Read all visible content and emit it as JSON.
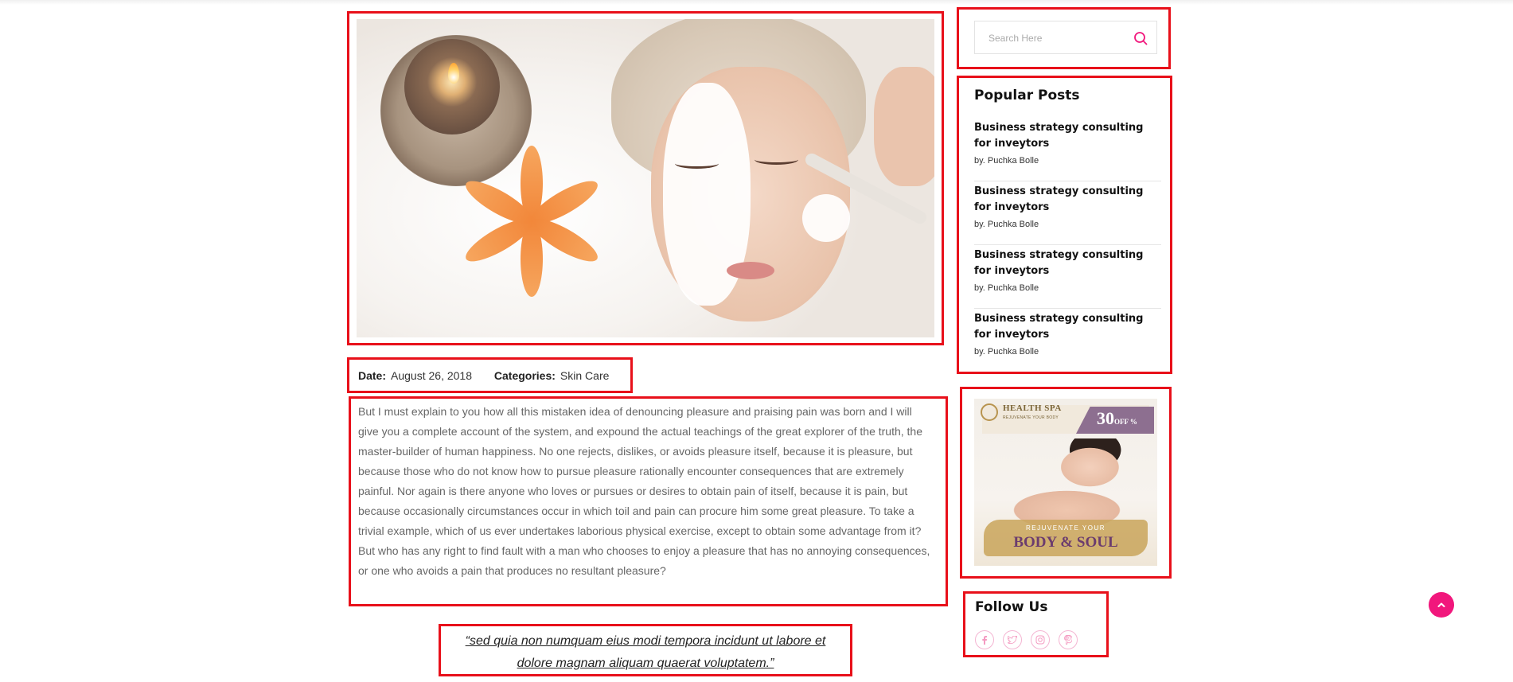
{
  "post": {
    "meta": {
      "date_label": "Date:",
      "date_value": "August 26, 2018",
      "categories_label": "Categories:",
      "categories_value": "Skin Care"
    },
    "body": "But I must explain to you how all this mistaken idea of denouncing pleasure and praising pain was born and I will give you a complete account of the system, and expound the actual teachings of the great explorer of the truth, the master-builder of human happiness. No one rejects, dislikes, or avoids pleasure itself, because it is pleasure, but because those who do not know how to pursue pleasure rationally encounter consequences that are extremely painful. Nor again is there anyone who loves or pursues or desires to obtain pain of itself, because it is pain, but because occasionally circumstances occur in which toil and pain can procure him some great pleasure. To take a trivial example, which of us ever undertakes laborious physical exercise, except to obtain some advantage from it? But who has any right to find fault with a man who chooses to enjoy a pleasure that has no annoying consequences, or one who avoids a pain that produces no resultant pleasure?",
    "quote": "“sed quia non numquam eius modi tempora incidunt ut labore et dolore magnam aliquam quaerat voluptatem.”"
  },
  "sidebar": {
    "search": {
      "placeholder": "Search Here",
      "icon": "search-icon"
    },
    "popular": {
      "title": "Popular Posts",
      "items": [
        {
          "title": "Business strategy consulting for inveytors",
          "by": "by. Puchka Bolle"
        },
        {
          "title": "Business strategy consulting for inveytors",
          "by": "by. Puchka Bolle"
        },
        {
          "title": "Business strategy consulting for inveytors",
          "by": "by. Puchka Bolle"
        },
        {
          "title": "Business strategy consulting for inveytors",
          "by": "by. Puchka Bolle"
        }
      ]
    },
    "ad": {
      "brand": "HEALTH SPA",
      "tagline": "REJUVENATE YOUR BODY",
      "discount": "30",
      "discount_suffix": "OFF %",
      "line1": "REJUVENATE YOUR",
      "line2": "BODY & SOUL"
    },
    "follow": {
      "title": "Follow Us",
      "icons": [
        "facebook-icon",
        "twitter-icon",
        "instagram-icon",
        "pinterest-icon"
      ]
    }
  },
  "colors": {
    "accent": "#f1177c",
    "highlight_box": "#e8101a"
  }
}
